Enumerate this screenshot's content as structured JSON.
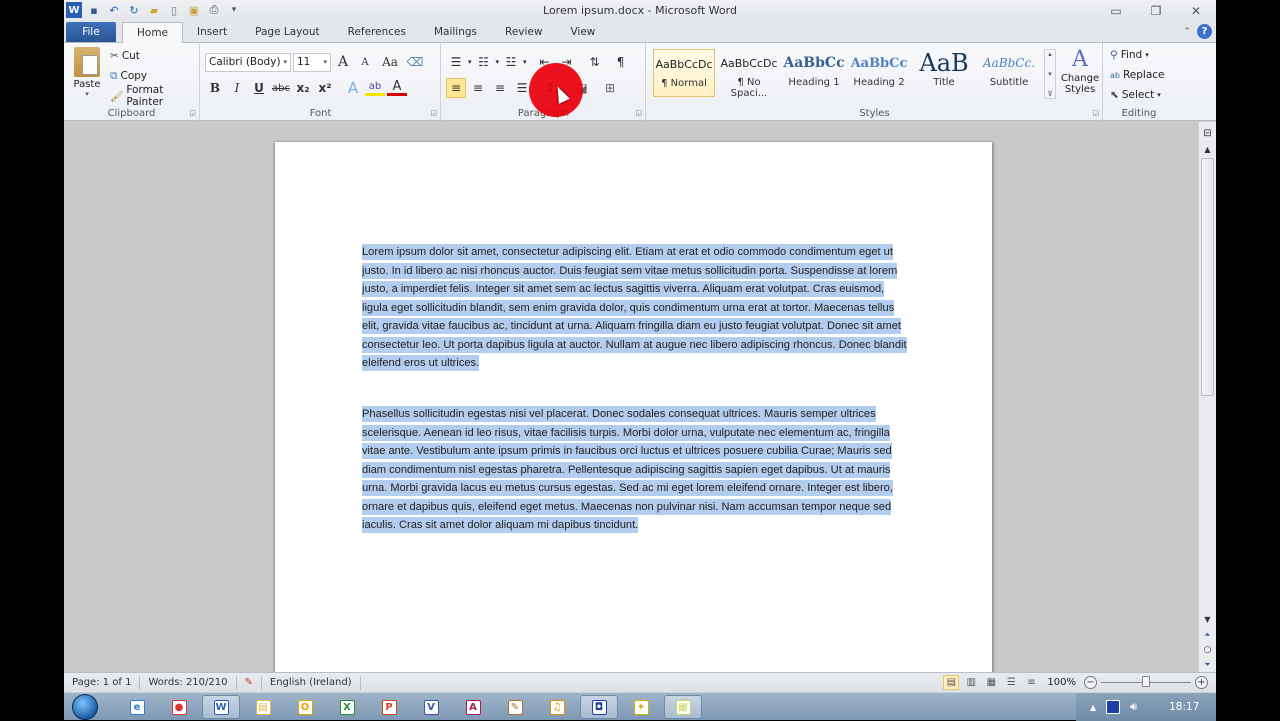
{
  "window": {
    "title": "Lorem ipsum.docx - Microsoft Word",
    "quick_access": [
      "word-logo-icon",
      "save-icon",
      "undo-icon",
      "redo-icon",
      "open-icon",
      "new-icon",
      "folder-icon",
      "print-preview-icon",
      "customize-icon"
    ],
    "controls": {
      "minimize": "▭",
      "restore": "❐",
      "close": "✕"
    }
  },
  "tabs": [
    {
      "label": "File"
    },
    {
      "label": "Home",
      "active": true
    },
    {
      "label": "Insert"
    },
    {
      "label": "Page Layout"
    },
    {
      "label": "References"
    },
    {
      "label": "Mailings"
    },
    {
      "label": "Review"
    },
    {
      "label": "View"
    }
  ],
  "ribbon": {
    "clipboard": {
      "label": "Clipboard",
      "paste": "Paste",
      "cut": "Cut",
      "copy": "Copy",
      "format_painter": "Format Painter"
    },
    "font": {
      "label": "Font",
      "font_name": "Calibri (Body)",
      "font_size": "11",
      "grow": "A",
      "shrink": "A",
      "change_case": "Aa",
      "bold": "B",
      "italic": "I",
      "underline": "U",
      "strikethrough": "abc",
      "subscript": "x₂",
      "superscript": "x²",
      "text_effects": "A",
      "highlight": "ab",
      "font_color": "A",
      "highlight_color": "#f2e600",
      "font_color_value": "#d00000"
    },
    "paragraph": {
      "label": "Paragraph"
    },
    "styles": {
      "label": "Styles",
      "items": [
        {
          "preview": "AaBbCcDc",
          "name": "¶ Normal",
          "selected": true
        },
        {
          "preview": "AaBbCcDc",
          "name": "¶ No Spaci..."
        },
        {
          "preview": "AaBbCc",
          "name": "Heading 1"
        },
        {
          "preview": "AaBbCc",
          "name": "Heading 2"
        },
        {
          "preview": "AaB",
          "name": "Title"
        },
        {
          "preview": "AaBbCc.",
          "name": "Subtitle"
        }
      ],
      "change_styles": "Change Styles"
    },
    "editing": {
      "label": "Editing",
      "find": "Find",
      "replace": "Replace",
      "select": "Select"
    }
  },
  "document": {
    "paragraphs": [
      "Lorem ipsum dolor sit amet, consectetur adipiscing elit. Etiam at erat et odio commodo condimentum eget ut justo. In id libero ac nisi rhoncus auctor. Duis feugiat sem vitae metus sollicitudin porta. Suspendisse at lorem justo, a imperdiet felis. Integer sit amet sem ac lectus sagittis viverra. Aliquam erat volutpat. Cras euismod, ligula eget sollicitudin blandit, sem enim gravida dolor, quis condimentum urna erat at tortor. Maecenas tellus elit, gravida vitae faucibus ac, tincidunt at urna. Aliquam fringilla diam eu justo feugiat volutpat. Donec sit amet consectetur leo. Ut porta dapibus ligula at auctor. Nullam at augue nec libero adipiscing rhoncus. Donec blandit eleifend eros ut ultrices.",
      "Phasellus sollicitudin egestas nisi vel placerat. Donec sodales consequat ultrices. Mauris semper ultrices scelerisque. Aenean id leo risus, vitae facilisis turpis. Morbi dolor urna, vulputate nec elementum ac, fringilla vitae ante. Vestibulum ante ipsum primis in faucibus orci luctus et ultrices posuere cubilia Curae; Mauris sed diam condimentum nisl egestas pharetra. Pellentesque adipiscing sagittis sapien eget dapibus. Ut at mauris urna. Morbi gravida lacus eu metus cursus egestas. Sed ac mi eget lorem eleifend ornare. Integer est libero, ornare et dapibus quis, eleifend eget metus. Maecenas non pulvinar nisi. Nam accumsan tempor neque sed iaculis. Cras sit amet dolor aliquam mi dapibus tincidunt."
    ],
    "selection_color": "#b3cdee"
  },
  "statusbar": {
    "page": "Page: 1 of 1",
    "words": "Words: 210/210",
    "language": "English (Ireland)",
    "zoom": "100%",
    "zoom_minus": "−",
    "zoom_plus": "+"
  },
  "taskbar": {
    "apps": [
      {
        "name": "internet-explorer",
        "glyph": "e",
        "color": "#2d7fd4"
      },
      {
        "name": "chrome",
        "glyph": "●",
        "color": "#d33"
      },
      {
        "name": "word",
        "glyph": "W",
        "color": "#2b5fb4",
        "open": true
      },
      {
        "name": "explorer",
        "glyph": "▤",
        "color": "#e0b64a"
      },
      {
        "name": "outlook",
        "glyph": "O",
        "color": "#e6a400"
      },
      {
        "name": "excel",
        "glyph": "X",
        "color": "#2a8a3a"
      },
      {
        "name": "powerpoint",
        "glyph": "P",
        "color": "#d24726"
      },
      {
        "name": "visio",
        "glyph": "V",
        "color": "#3a55b4"
      },
      {
        "name": "access",
        "glyph": "A",
        "color": "#a4214a"
      },
      {
        "name": "paint",
        "glyph": "✎",
        "color": "#b07030"
      },
      {
        "name": "audio",
        "glyph": "♫",
        "color": "#e09000"
      },
      {
        "name": "screen-recorder",
        "glyph": "◘",
        "color": "#1d3fa8",
        "open": true
      },
      {
        "name": "bird-app",
        "glyph": "✦",
        "color": "#d8b000"
      },
      {
        "name": "sticky-notes",
        "glyph": "▦",
        "color": "#c8d860",
        "open": true
      }
    ],
    "clock": "18:17"
  }
}
